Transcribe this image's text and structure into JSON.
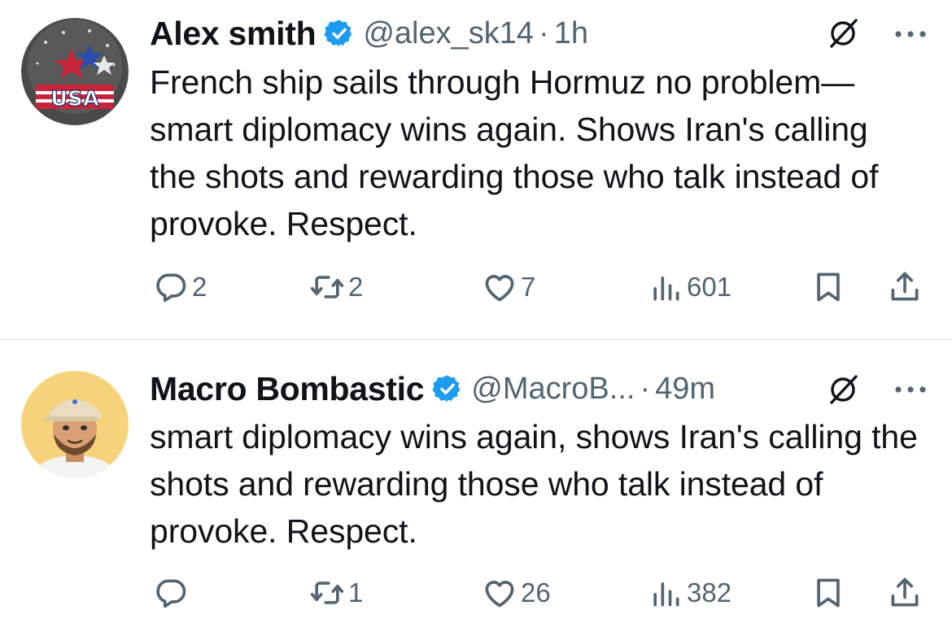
{
  "tweets": [
    {
      "display_name": "Alex smith",
      "handle": "@alex_sk14",
      "separator": "·",
      "time": "1h",
      "text": "French ship sails through Hormuz no problem—smart diplomacy wins again. Shows Iran's calling the shots and rewarding those who talk instead of provoke. Respect.",
      "avatar_text": "USA",
      "replies": "2",
      "reposts": "2",
      "likes": "7",
      "views": "601"
    },
    {
      "display_name": "Macro Bombastic",
      "handle": "@MacroB...",
      "separator": "·",
      "time": "49m",
      "text": "smart diplomacy wins again, shows Iran's calling the shots and rewarding those who talk instead of provoke. Respect.",
      "replies": "",
      "reposts": "1",
      "likes": "26",
      "views": "382"
    }
  ],
  "icons": [
    "verified-badge-icon",
    "grok-icon",
    "more-icon",
    "reply-icon",
    "repost-icon",
    "like-icon",
    "views-icon",
    "bookmark-icon",
    "share-icon"
  ],
  "colors": {
    "verified": "#1d9bf0",
    "secondary_text": "#536471",
    "primary_text": "#0f1419",
    "divider": "#dfe3e6"
  }
}
